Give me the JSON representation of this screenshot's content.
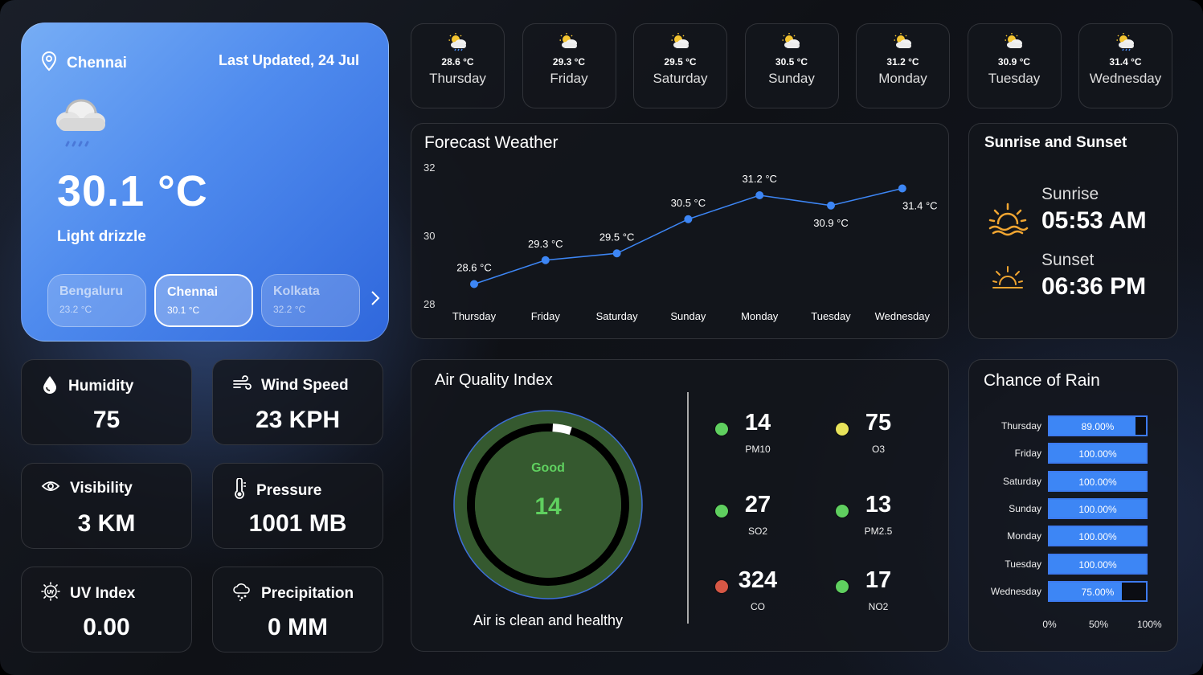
{
  "current": {
    "city": "Chennai",
    "last_updated": "Last Updated, 24 Jul",
    "temperature": "30.1 °C",
    "condition": "Light drizzle",
    "weather_icon": "cloud-drizzle-icon"
  },
  "cities": [
    {
      "name": "Bengaluru",
      "temp": "23.2 °C",
      "active": false
    },
    {
      "name": "Chennai",
      "temp": "30.1 °C",
      "active": true
    },
    {
      "name": "Kolkata",
      "temp": "32.2 °C",
      "active": false
    }
  ],
  "forecast_days": [
    {
      "temp": "28.6 °C",
      "day": "Thursday",
      "icon": "partly-cloudy-rain-icon"
    },
    {
      "temp": "29.3 °C",
      "day": "Friday",
      "icon": "partly-cloudy-icon"
    },
    {
      "temp": "29.5 °C",
      "day": "Saturday",
      "icon": "partly-cloudy-icon"
    },
    {
      "temp": "30.5 °C",
      "day": "Sunday",
      "icon": "partly-cloudy-icon"
    },
    {
      "temp": "31.2 °C",
      "day": "Monday",
      "icon": "partly-cloudy-icon"
    },
    {
      "temp": "30.9 °C",
      "day": "Tuesday",
      "icon": "partly-cloudy-icon"
    },
    {
      "temp": "31.4 °C",
      "day": "Wednesday",
      "icon": "partly-cloudy-rain-icon"
    }
  ],
  "forecast_chart": {
    "title": "Forecast Weather",
    "chart_data": {
      "type": "line",
      "categories": [
        "Thursday",
        "Friday",
        "Saturday",
        "Sunday",
        "Monday",
        "Tuesday",
        "Wednesday"
      ],
      "values": [
        28.6,
        29.3,
        29.5,
        30.5,
        31.2,
        30.9,
        31.4
      ],
      "labels": [
        "28.6 °C",
        "29.3 °C",
        "29.5 °C",
        "30.5 °C",
        "31.2 °C",
        "30.9 °C",
        "31.4 °C"
      ],
      "yticks": [
        "32",
        "30",
        "28"
      ],
      "ylim": [
        28,
        32
      ],
      "line_color": "#3d86f5"
    }
  },
  "sun": {
    "title": "Sunrise and Sunset",
    "sunrise_label": "Sunrise",
    "sunrise_time": "05:53 AM",
    "sunset_label": "Sunset",
    "sunset_time": "06:36 PM"
  },
  "stats": {
    "humidity": {
      "label": "Humidity",
      "value": "75",
      "icon": "droplet-icon"
    },
    "wind": {
      "label": "Wind Speed",
      "value": "23 KPH",
      "icon": "wind-icon"
    },
    "visibility": {
      "label": "Visibility",
      "value": "3 KM",
      "icon": "eye-icon"
    },
    "pressure": {
      "label": "Pressure",
      "value": "1001 MB",
      "icon": "thermometer-icon"
    },
    "uv": {
      "label": "UV Index",
      "value": "0.00",
      "icon": "uv-sun-icon"
    },
    "precip": {
      "label": "Precipitation",
      "value": "0 MM",
      "icon": "rain-cloud-icon"
    }
  },
  "aqi": {
    "title": "Air Quality Index",
    "status": "Good",
    "value": "14",
    "gauge_fraction": 0.03,
    "message": "Air is clean and healthy",
    "items": [
      {
        "value": "14",
        "name": "PM10",
        "color": "#5fcf5f"
      },
      {
        "value": "75",
        "name": "O3",
        "color": "#e8e35a"
      },
      {
        "value": "27",
        "name": "SO2",
        "color": "#5fcf5f"
      },
      {
        "value": "13",
        "name": "PM2.5",
        "color": "#5fcf5f"
      },
      {
        "value": "324",
        "name": "CO",
        "color": "#d65745"
      },
      {
        "value": "17",
        "name": "NO2",
        "color": "#5fcf5f"
      }
    ]
  },
  "rain": {
    "title": "Chance of Rain",
    "chart_data": {
      "type": "bar",
      "categories": [
        "Thursday",
        "Friday",
        "Saturday",
        "Sunday",
        "Monday",
        "Tuesday",
        "Wednesday"
      ],
      "values": [
        89,
        100,
        100,
        100,
        100,
        100,
        75
      ],
      "labels": [
        "89.00%",
        "100.00%",
        "100.00%",
        "100.00%",
        "100.00%",
        "100.00%",
        "75.00%"
      ],
      "xticks": [
        "0%",
        "50%",
        "100%"
      ],
      "xlim": [
        0,
        100
      ]
    }
  }
}
